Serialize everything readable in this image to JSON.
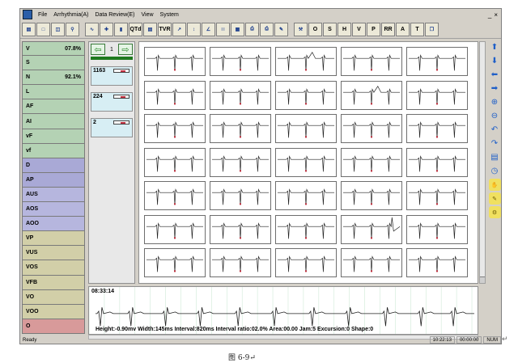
{
  "menu": {
    "items": [
      "File",
      "Arrhythmia(A)",
      "Data Review(E)",
      "View",
      "System"
    ],
    "window_buttons": [
      "_",
      "×"
    ]
  },
  "toolbar": {
    "labels": [
      "QTd",
      "TVR",
      "O",
      "S",
      "H",
      "V",
      "P",
      "RR",
      "A",
      "T"
    ]
  },
  "left_panel": {
    "items": [
      {
        "label": "V",
        "value": "07.8%",
        "color": "green"
      },
      {
        "label": "S",
        "value": "",
        "color": "green"
      },
      {
        "label": "N",
        "value": "92.1%",
        "color": "green"
      },
      {
        "label": "L",
        "value": "",
        "color": "green"
      },
      {
        "label": "AF",
        "value": "",
        "color": "green"
      },
      {
        "label": "AI",
        "value": "",
        "color": "green"
      },
      {
        "label": "vF",
        "value": "",
        "color": "green"
      },
      {
        "label": "vf",
        "value": "",
        "color": "green"
      },
      {
        "label": "D",
        "value": "",
        "color": "blue"
      },
      {
        "label": "AP",
        "value": "",
        "color": "blue"
      },
      {
        "label": "AUS",
        "value": "",
        "color": "lav"
      },
      {
        "label": "AOS",
        "value": "",
        "color": "lav"
      },
      {
        "label": "AOO",
        "value": "",
        "color": "lav"
      },
      {
        "label": "VP",
        "value": "",
        "color": "khaki"
      },
      {
        "label": "VUS",
        "value": "",
        "color": "khaki"
      },
      {
        "label": "VOS",
        "value": "",
        "color": "khaki"
      },
      {
        "label": "VFB",
        "value": "",
        "color": "khaki"
      },
      {
        "label": "VO",
        "value": "",
        "color": "khaki"
      },
      {
        "label": "VOO",
        "value": "",
        "color": "khaki"
      },
      {
        "label": "O",
        "value": "",
        "color": "pink"
      }
    ]
  },
  "templates": {
    "page_number": "1",
    "items": [
      {
        "count": "1163"
      },
      {
        "count": "224"
      },
      {
        "count": "2"
      }
    ]
  },
  "strip": {
    "time": "08:33:14",
    "measurements": "Height:-0.90mv  Width:145ms  Interval:820ms  Interval ratio:02.0%  Area:00.00  Jam:5  Excursion:0  Shape:0"
  },
  "statusbar": {
    "ready": "Ready",
    "time": "10:22:13",
    "time2": "00:00:00",
    "mode": "NUM"
  },
  "caption": "图    6-9↵",
  "pilcrow": "↵",
  "colors": {
    "green": "#b4d2b4",
    "blue": "#a9a9d6",
    "lav": "#b6b6de",
    "khaki": "#d2cfa8",
    "pink": "#d89a9a",
    "template_bg": "#d7eef4"
  }
}
